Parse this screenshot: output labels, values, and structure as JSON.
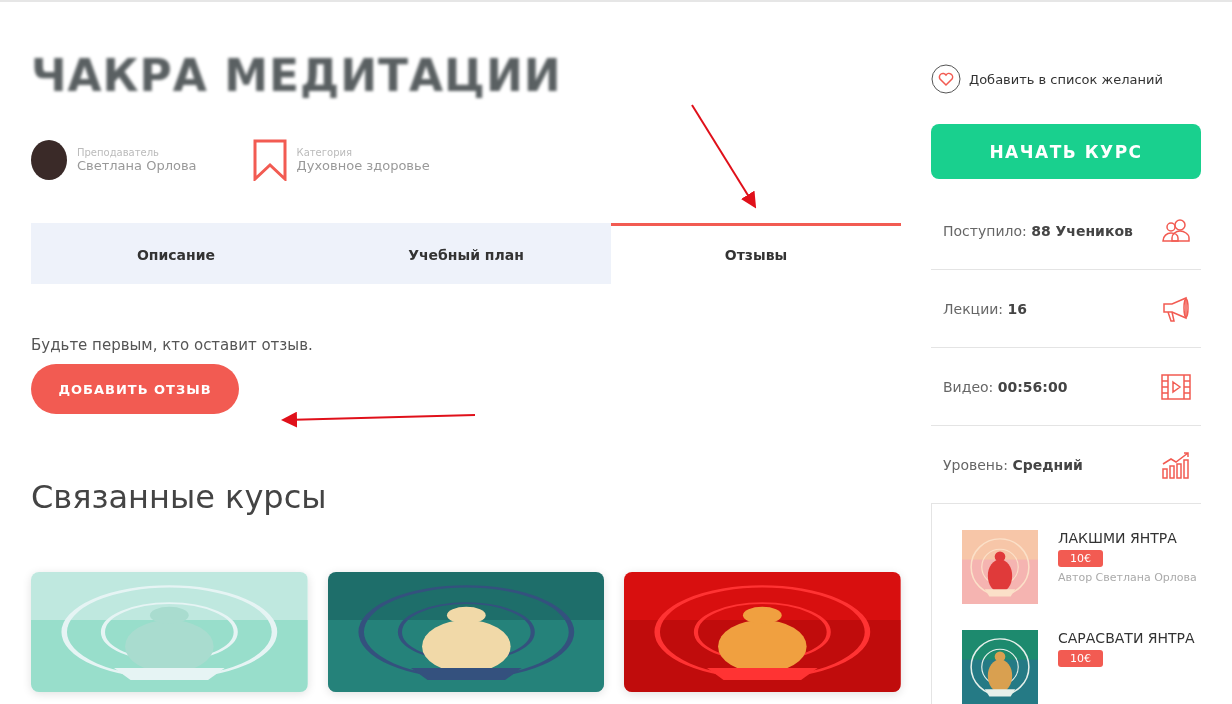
{
  "course": {
    "title": "ЧАКРА МЕДИТАЦИИ",
    "meta": [
      {
        "kind": "teacher",
        "label": "Преподаватель",
        "value": "Светлана Орлова"
      },
      {
        "kind": "category",
        "label": "Категория",
        "value": "Духовное здоровье"
      }
    ]
  },
  "tabs": [
    {
      "label": "Описание",
      "selected": false
    },
    {
      "label": "Учебный план",
      "selected": false
    },
    {
      "label": "Отзывы",
      "selected": true
    }
  ],
  "reviews": {
    "empty_text": "Будьте первым, кто оставит отзыв.",
    "add_button": "ДОБАВИТЬ ОТЗЫВ"
  },
  "related": {
    "heading": "Связанные курсы"
  },
  "sidebar": {
    "wishlist": "Добавить в список желаний",
    "start_button": "НАЧАТЬ КУРС",
    "stats": [
      {
        "kind": "students",
        "label": "Поступило:",
        "value": "88 Учеников"
      },
      {
        "kind": "lectures",
        "label": "Лекции:",
        "value": "16"
      },
      {
        "kind": "video",
        "label": "Видео:",
        "value": "00:56:00"
      },
      {
        "kind": "level",
        "label": "Уровень:",
        "value": "Средний"
      }
    ],
    "courses": [
      {
        "title": "ЛАКШМИ ЯНТРА",
        "price": "10€",
        "author": "Автор Светлана Орлова"
      },
      {
        "title": "САРАСВАТИ ЯНТРА",
        "price": "10€"
      }
    ]
  }
}
